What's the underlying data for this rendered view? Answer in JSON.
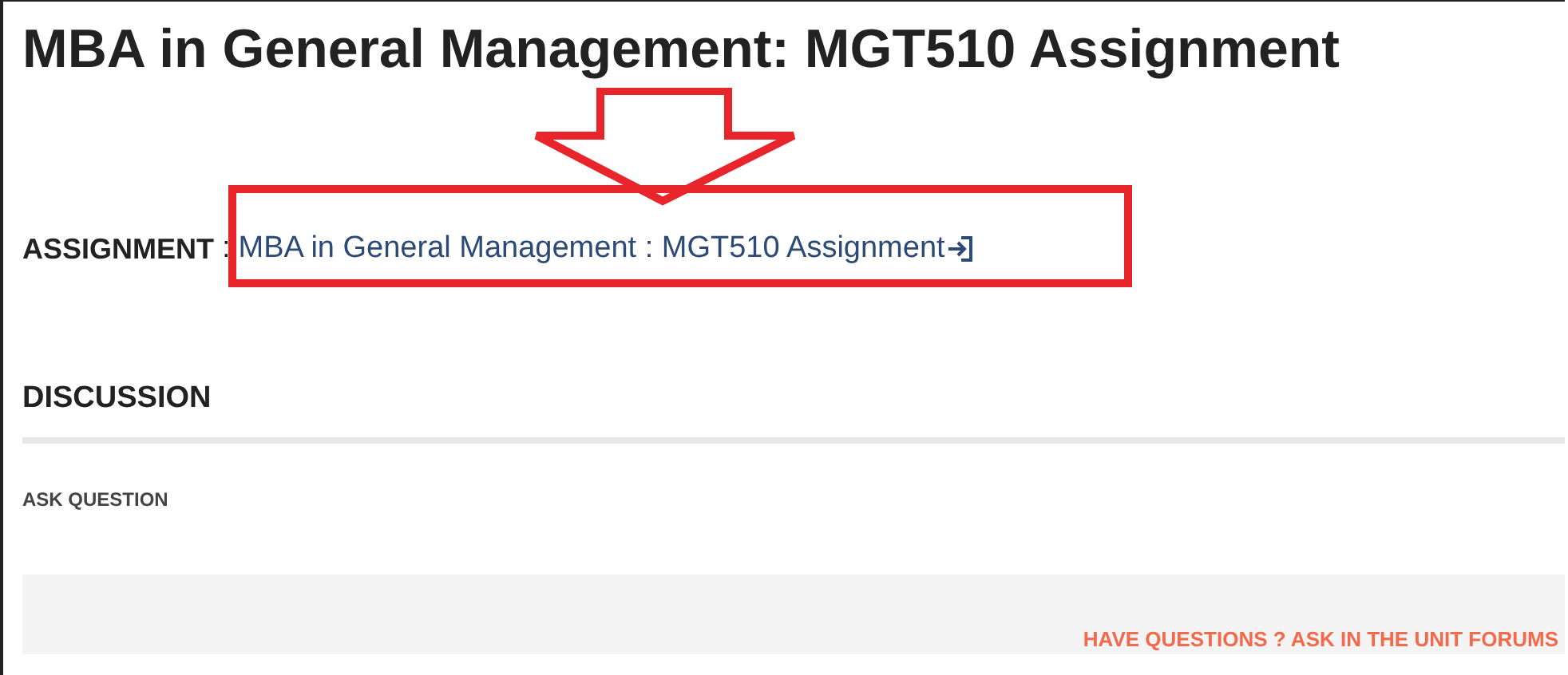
{
  "title": "MBA in General Management: MGT510 Assignment",
  "assignment": {
    "label": "ASSIGNMENT",
    "separator": ":",
    "link": "MBA in General Management : MGT510 Assignment"
  },
  "discussion": {
    "heading": "DISCUSSION",
    "ask_question": "ASK QUESTION",
    "forum_link": "HAVE QUESTIONS ? ASK IN THE UNIT FORUMS"
  }
}
